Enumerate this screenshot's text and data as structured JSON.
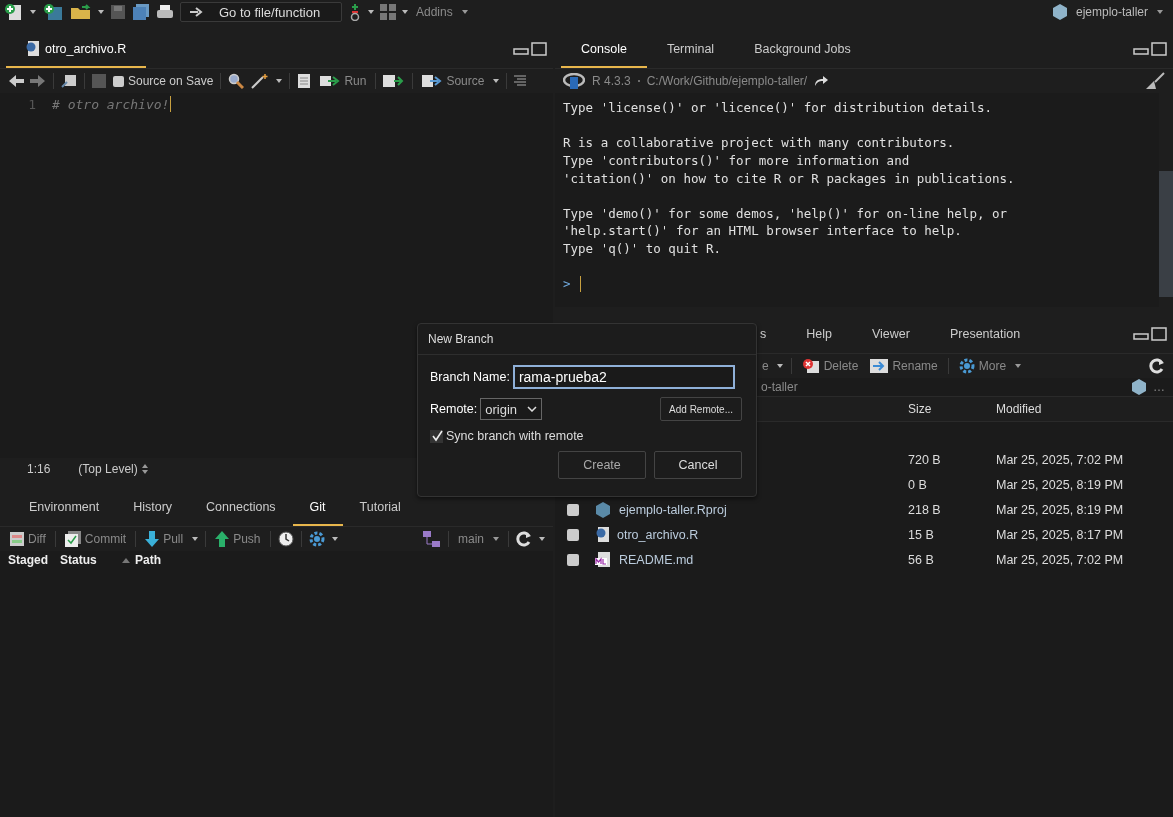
{
  "toolbar": {
    "goto": "Go to file/function",
    "addins": "Addins",
    "project": "ejemplo-taller"
  },
  "source": {
    "tabs": [
      {
        "label": "otro_archivo.R",
        "selected": true
      }
    ],
    "source_on_save": {
      "label": "Source on Save",
      "checked": false
    },
    "run": "Run",
    "source": "Source",
    "lines": [
      {
        "number": "1",
        "text": "# otro archivo!"
      }
    ],
    "position": "1:16",
    "scope": "(Top Level)"
  },
  "console": {
    "tabs": [
      {
        "label": "Console",
        "selected": true
      },
      {
        "label": "Terminal",
        "selected": false
      },
      {
        "label": "Background Jobs",
        "selected": false
      }
    ],
    "version": "R 4.3.3",
    "path": "C:/Work/Github/ejemplo-taller/",
    "paragraphs": [
      [
        "Type 'license()' or 'licence()' for distribution details."
      ],
      [
        "R is a collaborative project with many contributors.",
        "Type 'contributors()' for more information and",
        "'citation()' on how to cite R or R packages in publications."
      ],
      [
        "Type 'demo()' for some demos, 'help()' for on-line help, or",
        "'help.start()' for an HTML browser interface to help.",
        "Type 'q()' to quit R."
      ]
    ],
    "prompt": ">"
  },
  "git": {
    "tabs": [
      {
        "label": "Environment",
        "selected": false
      },
      {
        "label": "History",
        "selected": false
      },
      {
        "label": "Connections",
        "selected": false
      },
      {
        "label": "Git",
        "selected": true
      },
      {
        "label": "Tutorial",
        "selected": false
      }
    ],
    "diff": "Diff",
    "commit": "Commit",
    "pull": "Pull",
    "push": "Push",
    "branch": "main",
    "columns": [
      "Staged",
      "Status",
      "Path"
    ]
  },
  "files": {
    "tabs": [
      {
        "label": "s",
        "selected": false
      },
      {
        "label": "Help",
        "selected": false
      },
      {
        "label": "Viewer",
        "selected": false
      },
      {
        "label": "Presentation",
        "selected": false
      }
    ],
    "toolbar_fragment": "e",
    "delete": "Delete",
    "rename": "Rename",
    "more": "More",
    "breadcrumb": "o-taller",
    "more_dots": "…",
    "columns": [
      "Size",
      "Modified"
    ],
    "rows": [
      {
        "size": "720 B",
        "modified": "Mar 25, 2025, 7:02 PM"
      },
      {
        "size": "0 B",
        "modified": "Mar 25, 2025, 8:19 PM"
      },
      {
        "name": "ejemplo-taller.Rproj",
        "kind": "rproj",
        "checked": false,
        "size": "218 B",
        "modified": "Mar 25, 2025, 8:19 PM"
      },
      {
        "name": "otro_archivo.R",
        "kind": "r",
        "checked": false,
        "size": "15 B",
        "modified": "Mar 25, 2025, 8:17 PM"
      },
      {
        "name": "README.md",
        "kind": "md",
        "checked": false,
        "size": "56 B",
        "modified": "Mar 25, 2025, 7:02 PM"
      }
    ]
  },
  "dialog": {
    "title": "New Branch",
    "branch_label": "Branch Name:",
    "branch_value": "rama-prueba2",
    "remote_label": "Remote:",
    "remote_value": "origin",
    "add_remote": "Add Remote...",
    "sync": {
      "label": "Sync branch with remote",
      "checked": true
    },
    "create": "Create",
    "cancel": "Cancel"
  }
}
